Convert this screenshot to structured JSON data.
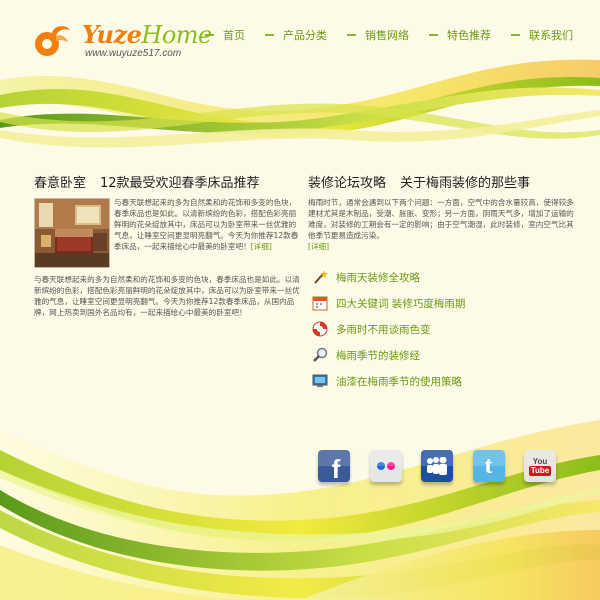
{
  "colors": {
    "brand_orange": "#f07f10",
    "brand_green": "#8cbd1a",
    "link_green": "#6a9a10",
    "background": "#fdfbe8"
  },
  "logo": {
    "name_part1": "Yuze",
    "name_part2": "Home",
    "url": "www.wuyuze517.com"
  },
  "nav": [
    "首页",
    "产品分类",
    "销售网络",
    "特色推荐",
    "联系我们"
  ],
  "left": {
    "title_a": "春意卧室",
    "title_b": "12款最受欢迎春季床品推荐",
    "intro": "与春天联想起来的多为自然柔和的花饰和多变的色块，春季床品也是如此。以清新缤纷的色彩，搭配色彩亮丽鲜明的花朵绽放其中，床品可以为卧室带来一丝优雅的气息，让睡室空间更显明亮翻气。今天为你推荐12款春季床品，一起来描绘心中最美的卧室吧！",
    "more": "[详细]",
    "body": "与春天联想起来的多为自然柔和的花饰和多变的色块，春季床品也是如此。以清新缤纷的色彩，搭配色彩亮丽鲜明的花朵绽放其中，床品可以为卧室带来一丝优雅的气息，让睡室空间更显明亮翻气。今天为你推荐12款春季床品，从国内品牌，网上热卖到国外名品均有，一起来描绘心中最美的卧室吧！"
  },
  "right": {
    "title_a": "装修论坛攻略",
    "title_b": "关于梅雨装修的那些事",
    "intro": "梅雨时节，通常会遇到以下两个问题：一方面，空气中的含水量较高，使得较多建材尤其是木制品，受潮、胀胀、变形；另一方面，阴雨天气多，增加了运输的难度，对装修的工期会有一定的影响；由于空气潮湿，此时装修，室内空气比其他季节更易造成污染。",
    "more": "[详细]",
    "links": [
      {
        "icon": "magic-wand-icon",
        "text": "梅雨天装修全攻略"
      },
      {
        "icon": "calendar-icon",
        "text": "四大关键词   装修巧度梅雨期"
      },
      {
        "icon": "lifebuoy-icon",
        "text": "多雨时不用谈雨色变"
      },
      {
        "icon": "magnifier-icon",
        "text": "梅雨季节的装修经"
      },
      {
        "icon": "monitor-icon",
        "text": "油漆在梅雨季节的使用策略"
      }
    ]
  },
  "social": [
    "facebook",
    "flickr",
    "myspace",
    "twitter",
    "youtube"
  ],
  "social_glyphs": {
    "facebook": "f",
    "twitter": "t",
    "youtube_top": "You",
    "youtube_bottom": "Tube"
  }
}
